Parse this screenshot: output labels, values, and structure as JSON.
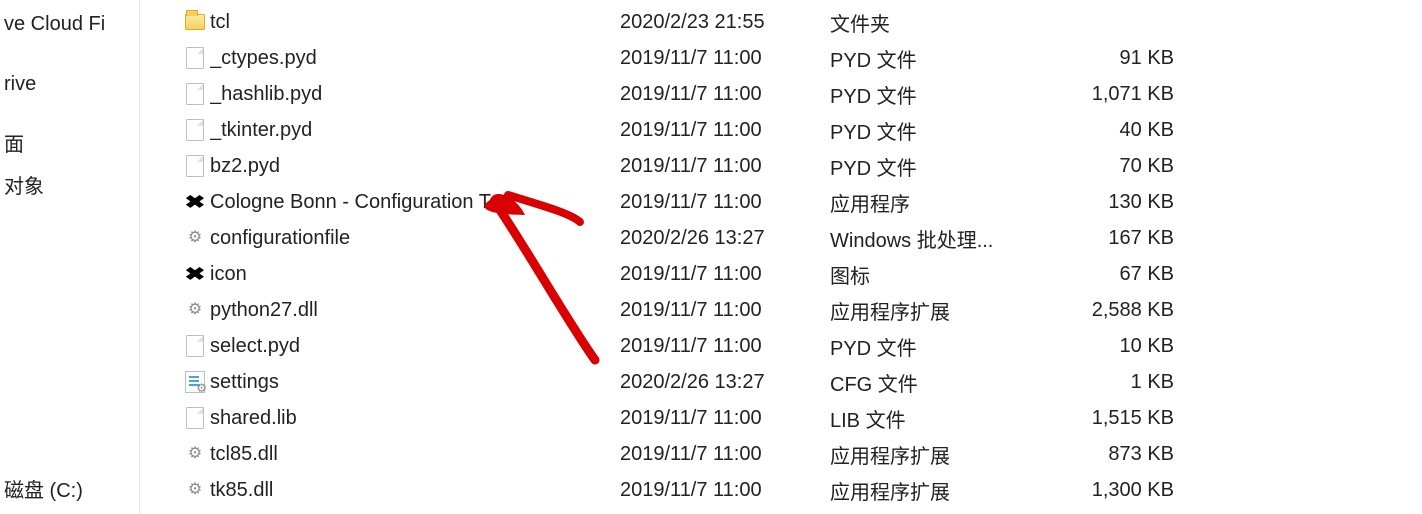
{
  "nav": {
    "items": [
      {
        "label": "ve Cloud Fi"
      },
      {
        "label": "rive"
      },
      {
        "label": "面"
      },
      {
        "label": "对象"
      }
    ],
    "bottom": {
      "label": "磁盘 (C:)"
    }
  },
  "files": [
    {
      "icon": "folder",
      "name": "tcl",
      "date": "2020/2/23 21:55",
      "type": "文件夹",
      "size": ""
    },
    {
      "icon": "file",
      "name": "_ctypes.pyd",
      "date": "2019/11/7 11:00",
      "type": "PYD 文件",
      "size": "91 KB"
    },
    {
      "icon": "file",
      "name": "_hashlib.pyd",
      "date": "2019/11/7 11:00",
      "type": "PYD 文件",
      "size": "1,071 KB"
    },
    {
      "icon": "file",
      "name": "_tkinter.pyd",
      "date": "2019/11/7 11:00",
      "type": "PYD 文件",
      "size": "40 KB"
    },
    {
      "icon": "file",
      "name": "bz2.pyd",
      "date": "2019/11/7 11:00",
      "type": "PYD 文件",
      "size": "70 KB"
    },
    {
      "icon": "exe",
      "name": "Cologne Bonn - Configuration Tool",
      "date": "2019/11/7 11:00",
      "type": "应用程序",
      "size": "130 KB"
    },
    {
      "icon": "gear",
      "name": "configurationfile",
      "date": "2020/2/26 13:27",
      "type": "Windows 批处理...",
      "size": "167 KB"
    },
    {
      "icon": "ico",
      "name": "icon",
      "date": "2019/11/7 11:00",
      "type": "图标",
      "size": "67 KB"
    },
    {
      "icon": "gear",
      "name": "python27.dll",
      "date": "2019/11/7 11:00",
      "type": "应用程序扩展",
      "size": "2,588 KB"
    },
    {
      "icon": "file",
      "name": "select.pyd",
      "date": "2019/11/7 11:00",
      "type": "PYD 文件",
      "size": "10 KB"
    },
    {
      "icon": "cfg",
      "name": "settings",
      "date": "2020/2/26 13:27",
      "type": "CFG 文件",
      "size": "1 KB"
    },
    {
      "icon": "file",
      "name": "shared.lib",
      "date": "2019/11/7 11:00",
      "type": "LIB 文件",
      "size": "1,515 KB"
    },
    {
      "icon": "gear",
      "name": "tcl85.dll",
      "date": "2019/11/7 11:00",
      "type": "应用程序扩展",
      "size": "873 KB"
    },
    {
      "icon": "gear",
      "name": "tk85.dll",
      "date": "2019/11/7 11:00",
      "type": "应用程序扩展",
      "size": "1,300 KB"
    }
  ]
}
